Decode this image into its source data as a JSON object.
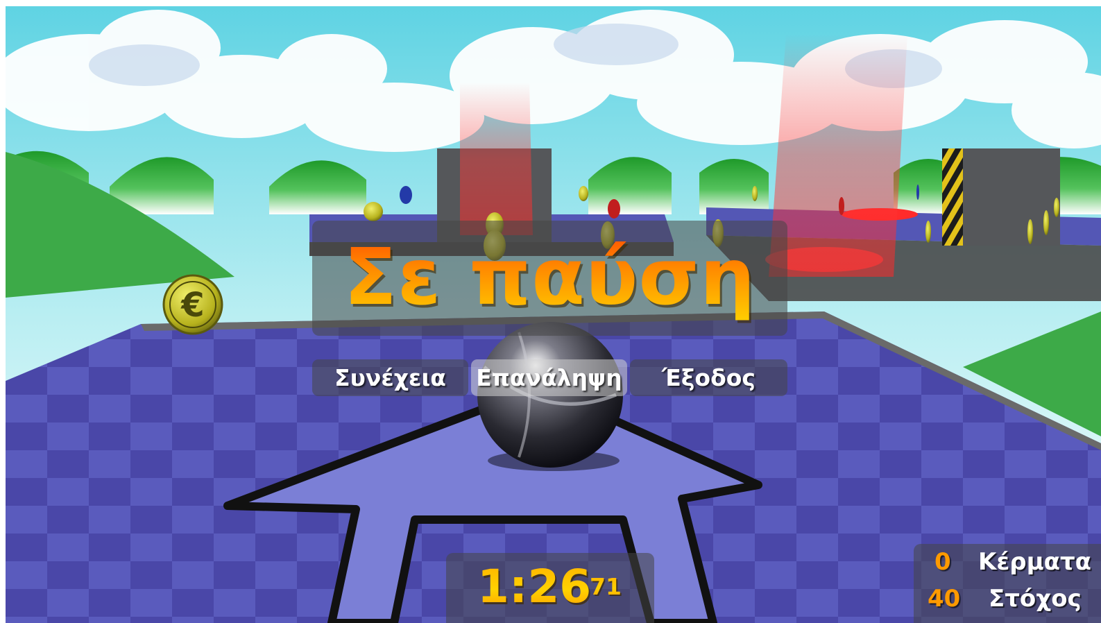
{
  "pause_menu": {
    "title": "Σε παύση",
    "buttons": [
      {
        "label": "Συνέχεια",
        "selected": false
      },
      {
        "label": "Επανάληψη",
        "selected": true
      },
      {
        "label": "Έξοδος",
        "selected": false
      }
    ]
  },
  "timer": {
    "main": "1:26",
    "fraction": "71"
  },
  "hud": {
    "coins_value": "0",
    "coins_label": "Κέρματα",
    "goal_value": "40",
    "goal_label": "Στόχος"
  },
  "colors": {
    "sky": "#6fd6e6",
    "floor": "#4a45a8",
    "title_top": "#ff4a00",
    "title_bottom": "#ffd500",
    "hud_number": "#ff9a00"
  },
  "scene_icons": [
    "euro-coin-icon",
    "marble-ball",
    "arrow-floor-marking",
    "goal-target"
  ]
}
